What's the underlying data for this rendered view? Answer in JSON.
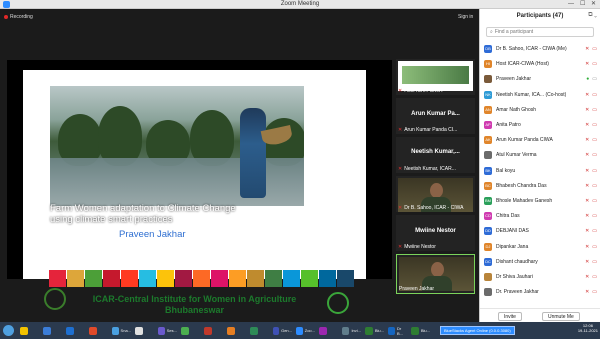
{
  "window": {
    "title": "Zoom Meeting",
    "controls": [
      "—",
      "☐",
      "✕"
    ]
  },
  "meeting": {
    "recording_label": "Recording",
    "signin_label": "Sign in",
    "slide": {
      "title": "Farm Women adaptation to Climate Change using climate smart practices",
      "author": "Praveen Jakhar",
      "institute_line1": "ICAR-Central Institute for Women in Agriculture",
      "institute_line2": "Bhubaneswar",
      "sdg_colors": [
        "#e5243b",
        "#dda63a",
        "#4c9f38",
        "#c5192d",
        "#ff3a21",
        "#26bde2",
        "#fcc30b",
        "#a21942",
        "#fd6925",
        "#dd1367",
        "#fd9d24",
        "#bf8b2e",
        "#3f7e44",
        "#0a97d9",
        "#56c02b",
        "#00689d",
        "#19486a"
      ]
    },
    "tiles": [
      {
        "type": "slide",
        "caption": "Host ICAR-CIWA"
      },
      {
        "type": "name",
        "name": "Arun Kumar Pa...",
        "caption": "Arun Kumar Panda CI..."
      },
      {
        "type": "name",
        "name": "Neetish Kumar,...",
        "caption": "Neetish Kumar, ICAR..."
      },
      {
        "type": "person",
        "caption": "Dr B. Sahoo, ICAR - CIWA"
      },
      {
        "type": "name",
        "name": "Mwiine Nestor",
        "caption": "Mwiine Nestor"
      },
      {
        "type": "person",
        "caption": "Praveen Jakhar"
      }
    ]
  },
  "participants": {
    "title": "Participants (47)",
    "search_placeholder": "Find a participant",
    "list": [
      {
        "initials": "DB",
        "color": "#2e6bd6",
        "name": "Dr B. Sahoo, ICAR - CIWA (Me)"
      },
      {
        "initials": "HI",
        "color": "#e0852a",
        "name": "Host ICAR-CIWA (Host)"
      },
      {
        "initials": "",
        "color": "#7a5a3a",
        "name": "Praveen Jakhar",
        "speaking": true
      },
      {
        "initials": "NK",
        "color": "#2e9bd6",
        "name": "Neetish Kumar, ICA... (Co-host)"
      },
      {
        "initials": "AN",
        "color": "#e0852a",
        "name": "Amar Nath Ghosh"
      },
      {
        "initials": "AP",
        "color": "#d03bb0",
        "name": "Anita Patro"
      },
      {
        "initials": "AK",
        "color": "#e0852a",
        "name": "Arun Kumar Panda CIWA"
      },
      {
        "initials": "",
        "color": "#6b6b6b",
        "name": "Atul Kumar Verma"
      },
      {
        "initials": "BK",
        "color": "#2e6bd6",
        "name": "Bal koyu"
      },
      {
        "initials": "BC",
        "color": "#e0852a",
        "name": "Bhabesh Chandra Das"
      },
      {
        "initials": "BM",
        "color": "#2aa05a",
        "name": "Bhosle Mahadev Ganesh"
      },
      {
        "initials": "CD",
        "color": "#d03bb0",
        "name": "Chitra Das"
      },
      {
        "initials": "DD",
        "color": "#2e6bd6",
        "name": "DEBJANI DAS"
      },
      {
        "initials": "DJ",
        "color": "#e0852a",
        "name": "Dipankar Jana"
      },
      {
        "initials": "DC",
        "color": "#2e6bd6",
        "name": "Dishant chaudhary"
      },
      {
        "initials": "",
        "color": "#b8843a",
        "name": "Dr Shiva Jauhari"
      },
      {
        "initials": "",
        "color": "#6b6b6b",
        "name": "Dr. Praveen Jakhar"
      }
    ],
    "invite_label": "Invite",
    "unmute_label": "Unmute Me"
  },
  "taskbar": {
    "apps": [
      "",
      "",
      "",
      "",
      "Sna...",
      "",
      "Ses...",
      "",
      "",
      "",
      "",
      "Gen...",
      "Zoo...",
      "",
      "Invi...",
      "Blu...",
      "Dr B...",
      "Blu..."
    ],
    "agent_label": "BlueStacks Agent Online (0.0.0.3080)",
    "time": "12:06",
    "date": "19-11-2021"
  }
}
